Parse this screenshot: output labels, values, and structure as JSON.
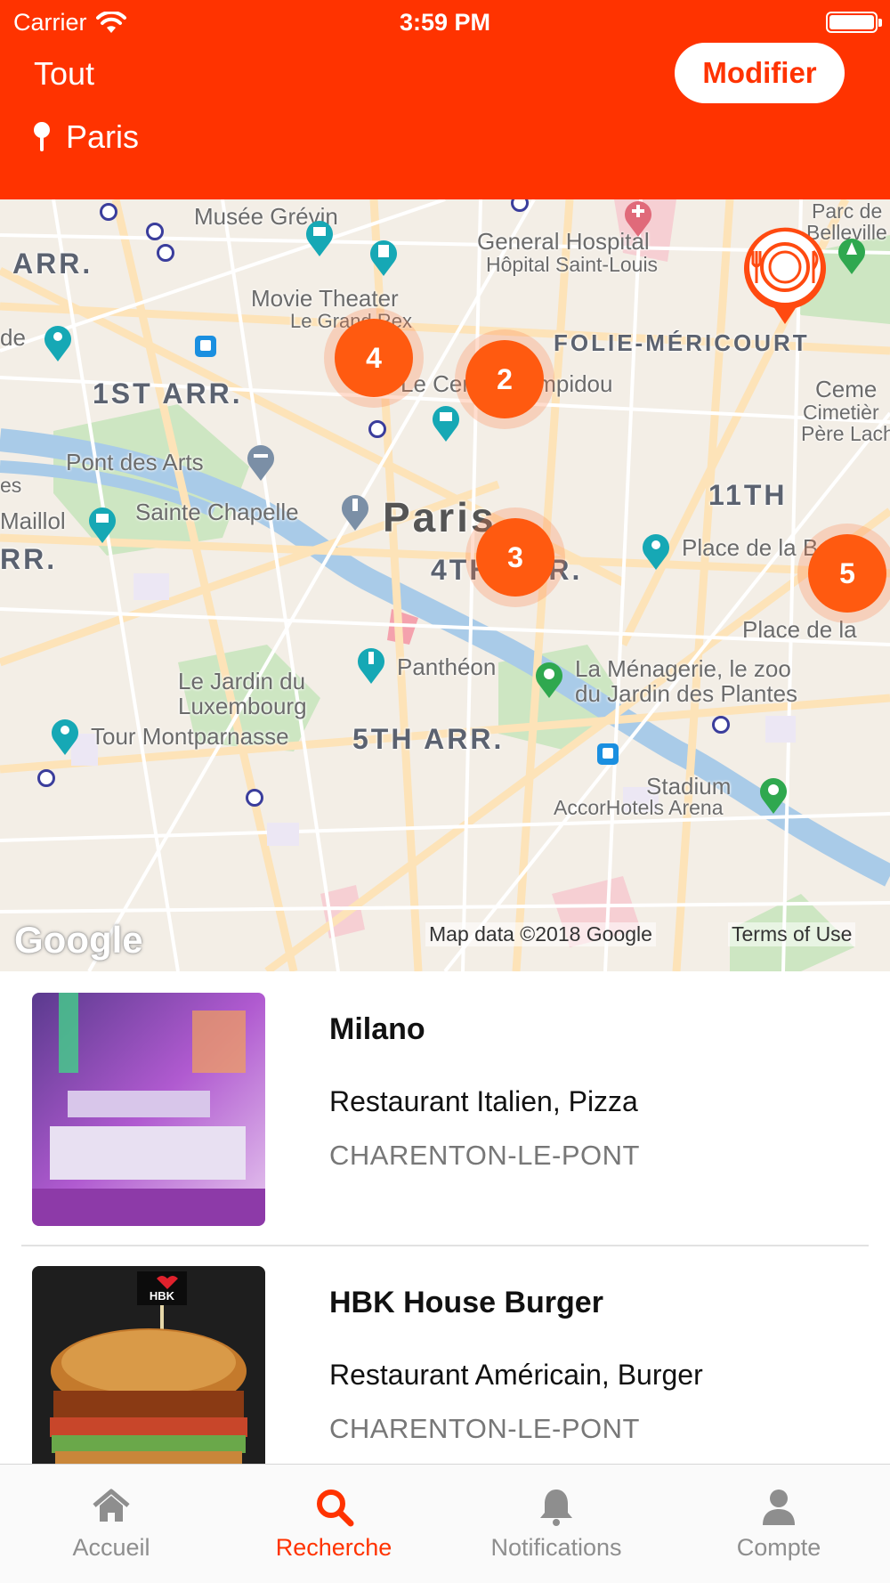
{
  "status_bar": {
    "carrier": "Carrier",
    "time": "3:59 PM"
  },
  "header": {
    "filter": "Tout",
    "location": "Paris",
    "modify_label": "Modifier",
    "background_color": "#ff3300"
  },
  "map": {
    "labels": {
      "musee_grevin": "Musée Grévin",
      "general_hospital": "General Hospital",
      "hopital_saint_louis": "Hôpital Saint-Louis",
      "parc_belleville_1": "Parc de",
      "parc_belleville_2": "Belleville",
      "arr_left": "ARR.",
      "movie_theater_1": "Movie Theater",
      "movie_theater_2": "Le Grand Rex",
      "folie_mericourt": "FOLIE-MÉRICOURT",
      "de_left": "de",
      "first_arr": "1ST ARR.",
      "centre_pompidou": "Le Centre Pompidou",
      "cemetery_1": "Ceme",
      "cemetery_2": "Cimetièr",
      "cemetery_3": "Père Lach",
      "pont_des_arts": "Pont des Arts",
      "es_left": "es",
      "eleventh": "11TH",
      "maillol": "Maillol",
      "sainte_chapelle": "Sainte Chapelle",
      "paris": "Paris",
      "place_bastille": "Place de la Bastil",
      "rr_left": "RR.",
      "fourth_arr": "4TH ARR.",
      "place_de_la": "Place de la",
      "jardin_1": "Le Jardin du",
      "jardin_2": "Luxembourg",
      "pantheon": "Panthéon",
      "menagerie_1": "La Ménagerie, le zoo",
      "menagerie_2": "du Jardin des Plantes",
      "tour_montparnasse": "Tour Montparnasse",
      "fifth_arr": "5TH ARR.",
      "stadium": "Stadium",
      "accorhotels": "AccorHotels Arena"
    },
    "clusters": [
      {
        "count": "4"
      },
      {
        "count": "2"
      },
      {
        "count": "3"
      },
      {
        "count": "5"
      }
    ],
    "google_logo": "Google",
    "attribution": "Map data ©2018 Google",
    "terms": "Terms of Use"
  },
  "restaurants": [
    {
      "name": "Milano",
      "category": "Restaurant Italien, Pizza",
      "city": "CHARENTON-LE-PONT"
    },
    {
      "name": "HBK House Burger",
      "category": "Restaurant Américain, Burger",
      "city": "CHARENTON-LE-PONT",
      "sign_text": "HBK"
    }
  ],
  "tabs": [
    {
      "label": "Accueil",
      "icon": "home-icon"
    },
    {
      "label": "Recherche",
      "icon": "search-icon",
      "active": true
    },
    {
      "label": "Notifications",
      "icon": "bell-icon"
    },
    {
      "label": "Compte",
      "icon": "user-icon"
    }
  ],
  "colors": {
    "accent": "#ff3300",
    "cluster": "#ff5a10",
    "inactive_tab": "#8e8e8e"
  }
}
